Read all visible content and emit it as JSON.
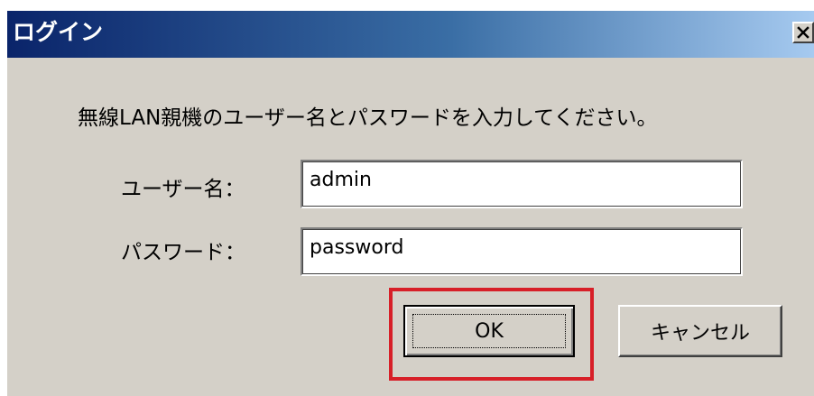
{
  "window": {
    "title": "ログイン",
    "close_label": "×"
  },
  "dialog": {
    "message": "無線LAN親機のユーザー名とパスワードを入力してください。",
    "username_label": "ユーザー名：",
    "username_value": "admin",
    "password_label": "パスワード：",
    "password_value": "password"
  },
  "buttons": {
    "ok_label": "OK",
    "cancel_label": "キャンセル"
  },
  "colors": {
    "dialog_bg": "#d4d0c8",
    "title_gradient_start": "#0a246a",
    "title_gradient_end": "#a6caf0",
    "highlight": "#d71f28"
  },
  "icons": {
    "close": "close-icon"
  }
}
